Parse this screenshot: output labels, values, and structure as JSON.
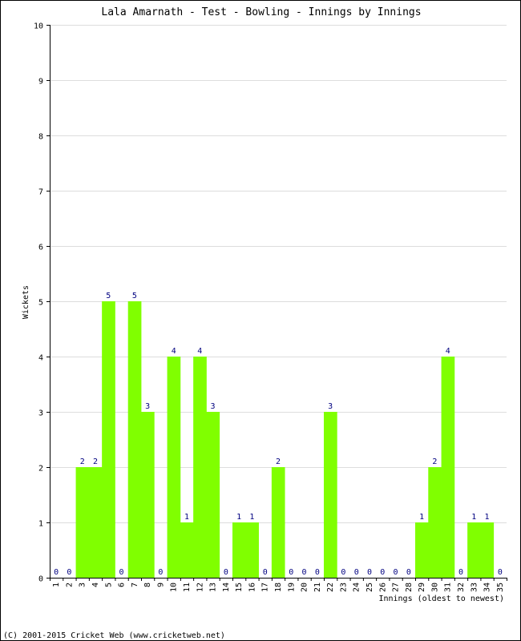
{
  "chart_data": {
    "type": "bar",
    "title": "Lala Amarnath - Test - Bowling - Innings by Innings",
    "xlabel": "Innings (oldest to newest)",
    "ylabel": "Wickets",
    "ylim": [
      0,
      10
    ],
    "yticks": [
      0,
      1,
      2,
      3,
      4,
      5,
      6,
      7,
      8,
      9,
      10
    ],
    "grid": true,
    "categories": [
      "1",
      "2",
      "3",
      "4",
      "5",
      "6",
      "7",
      "8",
      "9",
      "10",
      "11",
      "12",
      "13",
      "14",
      "15",
      "16",
      "17",
      "18",
      "19",
      "20",
      "21",
      "22",
      "23",
      "24",
      "25",
      "26",
      "27",
      "28",
      "29",
      "30",
      "31",
      "32",
      "33",
      "34",
      "35"
    ],
    "values": [
      0,
      0,
      2,
      2,
      5,
      0,
      5,
      3,
      0,
      4,
      1,
      4,
      3,
      0,
      1,
      1,
      0,
      2,
      0,
      0,
      0,
      3,
      0,
      0,
      0,
      0,
      0,
      0,
      1,
      2,
      4,
      0,
      1,
      1,
      0
    ],
    "bar_color": "#80ff00",
    "label_color": "#000080",
    "grid_color": "#dddddd"
  },
  "footer": "(C) 2001-2015 Cricket Web (www.cricketweb.net)"
}
